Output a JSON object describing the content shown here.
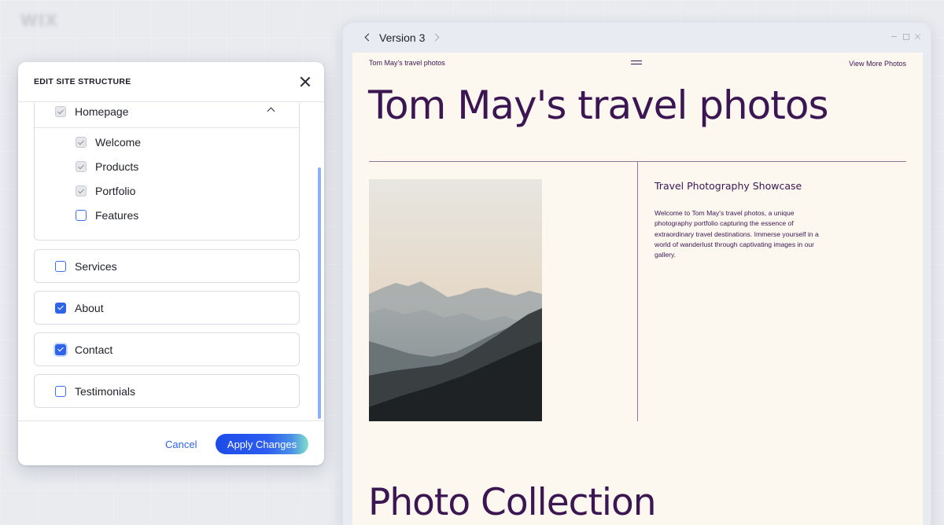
{
  "background": {
    "logo_text": "WIX"
  },
  "dialog": {
    "title": "EDIT SITE STRUCTURE",
    "group": {
      "label": "Homepage",
      "children": [
        {
          "label": "Welcome",
          "state": "disabled-checked"
        },
        {
          "label": "Products",
          "state": "disabled-checked"
        },
        {
          "label": "Portfolio",
          "state": "disabled-checked"
        },
        {
          "label": "Features",
          "state": "unchecked"
        }
      ]
    },
    "pages": [
      {
        "label": "Services",
        "state": "unchecked"
      },
      {
        "label": "About",
        "state": "checked"
      },
      {
        "label": "Contact",
        "state": "checked-focused"
      },
      {
        "label": "Testimonials",
        "state": "unchecked"
      }
    ],
    "cancel_label": "Cancel",
    "apply_label": "Apply Changes"
  },
  "preview": {
    "version_title": "Version 3",
    "site": {
      "brand": "Tom May's travel photos",
      "nav_link": "View More Photos",
      "hero_title": "Tom May's travel photos",
      "section_title": "Travel Photography Showcase",
      "section_text": "Welcome to Tom May's travel photos, a unique photography portfolio capturing the essence of extraordinary travel destinations. Immerse yourself in a world of wanderlust through captivating images in our gallery.",
      "collection_title": "Photo Collection"
    }
  },
  "colors": {
    "accent_blue": "#2f63e8",
    "site_text_purple": "#3b1652",
    "site_background": "#fcf8ef"
  }
}
